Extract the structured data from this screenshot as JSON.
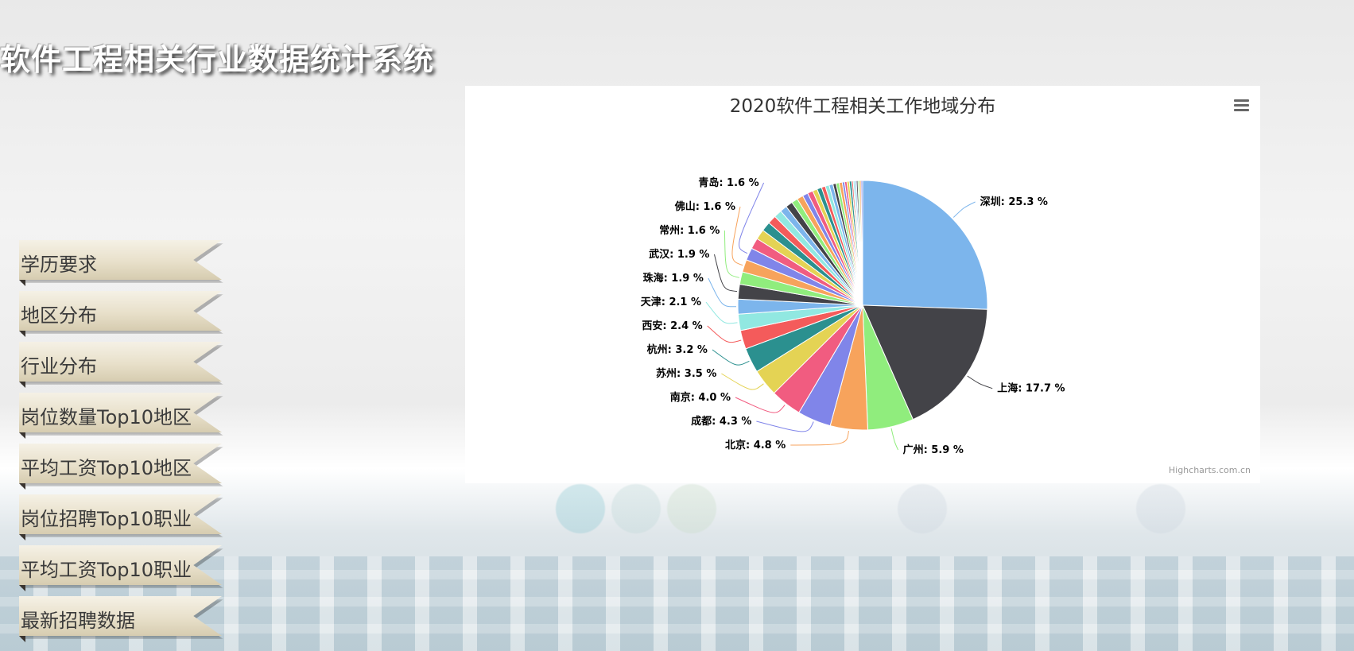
{
  "app": {
    "title": "软件工程相关行业数据统计系统"
  },
  "nav": {
    "items": [
      {
        "label": "学历要求"
      },
      {
        "label": "地区分布"
      },
      {
        "label": "行业分布"
      },
      {
        "label": "岗位数量Top10地区"
      },
      {
        "label": "平均工资Top10地区"
      },
      {
        "label": "岗位招聘Top10职业"
      },
      {
        "label": "平均工资Top10职业"
      },
      {
        "label": "最新招聘数据"
      }
    ]
  },
  "chart": {
    "menu_icon": "hamburger-menu-icon",
    "credit": "Highcharts.com.cn"
  },
  "chart_data": {
    "type": "pie",
    "title": "2020软件工程相关工作地域分布",
    "unit": "%",
    "start_angle_deg": 0,
    "direction": "clockwise",
    "slices": [
      {
        "name": "深圳",
        "value": 25.3,
        "color": "#7cb5ec",
        "labeled": true
      },
      {
        "name": "上海",
        "value": 17.7,
        "color": "#434348",
        "labeled": true
      },
      {
        "name": "广州",
        "value": 5.9,
        "color": "#90ed7d",
        "labeled": true
      },
      {
        "name": "北京",
        "value": 4.8,
        "color": "#f7a35c",
        "labeled": true
      },
      {
        "name": "成都",
        "value": 4.3,
        "color": "#8085e9",
        "labeled": true
      },
      {
        "name": "南京",
        "value": 4.0,
        "color": "#f15c80",
        "labeled": true
      },
      {
        "name": "苏州",
        "value": 3.5,
        "color": "#e4d354",
        "labeled": true
      },
      {
        "name": "杭州",
        "value": 3.2,
        "color": "#2b908f",
        "labeled": true
      },
      {
        "name": "西安",
        "value": 2.4,
        "color": "#f45b5b",
        "labeled": true
      },
      {
        "name": "天津",
        "value": 2.1,
        "color": "#91e8e1",
        "labeled": true
      },
      {
        "name": "珠海",
        "value": 1.9,
        "color": "#7cb5ec",
        "labeled": true
      },
      {
        "name": "武汉",
        "value": 1.9,
        "color": "#434348",
        "labeled": true
      },
      {
        "name": "常州",
        "value": 1.6,
        "color": "#90ed7d",
        "labeled": true
      },
      {
        "name": "佛山",
        "value": 1.6,
        "color": "#f7a35c",
        "labeled": true
      },
      {
        "name": "青岛",
        "value": 1.6,
        "color": "#8085e9",
        "labeled": true
      },
      {
        "value": 1.4,
        "color": "#f15c80",
        "labeled": false
      },
      {
        "value": 1.3,
        "color": "#e4d354",
        "labeled": false
      },
      {
        "value": 1.2,
        "color": "#2b908f",
        "labeled": false
      },
      {
        "value": 1.1,
        "color": "#f45b5b",
        "labeled": false
      },
      {
        "value": 1.0,
        "color": "#91e8e1",
        "labeled": false
      },
      {
        "value": 0.9,
        "color": "#7cb5ec",
        "labeled": false
      },
      {
        "value": 0.9,
        "color": "#434348",
        "labeled": false
      },
      {
        "value": 0.8,
        "color": "#90ed7d",
        "labeled": false
      },
      {
        "value": 0.8,
        "color": "#f7a35c",
        "labeled": false
      },
      {
        "value": 0.7,
        "color": "#8085e9",
        "labeled": false
      },
      {
        "value": 0.7,
        "color": "#f15c80",
        "labeled": false
      },
      {
        "value": 0.6,
        "color": "#e4d354",
        "labeled": false
      },
      {
        "value": 0.6,
        "color": "#2b908f",
        "labeled": false
      },
      {
        "value": 0.5,
        "color": "#f45b5b",
        "labeled": false
      },
      {
        "value": 0.5,
        "color": "#91e8e1",
        "labeled": false
      },
      {
        "value": 0.5,
        "color": "#7cb5ec",
        "labeled": false
      },
      {
        "value": 0.4,
        "color": "#434348",
        "labeled": false
      },
      {
        "value": 0.4,
        "color": "#90ed7d",
        "labeled": false
      },
      {
        "value": 0.4,
        "color": "#f7a35c",
        "labeled": false
      },
      {
        "value": 0.3,
        "color": "#8085e9",
        "labeled": false
      },
      {
        "value": 0.3,
        "color": "#f15c80",
        "labeled": false
      },
      {
        "value": 0.3,
        "color": "#e4d354",
        "labeled": false
      },
      {
        "value": 0.3,
        "color": "#2b908f",
        "labeled": false
      },
      {
        "value": 0.2,
        "color": "#f45b5b",
        "labeled": false
      },
      {
        "value": 0.2,
        "color": "#91e8e1",
        "labeled": false
      },
      {
        "value": 0.2,
        "color": "#7cb5ec",
        "labeled": false
      },
      {
        "value": 0.2,
        "color": "#434348",
        "labeled": false
      },
      {
        "value": 0.2,
        "color": "#90ed7d",
        "labeled": false
      },
      {
        "value": 0.2,
        "color": "#f7a35c",
        "labeled": false
      },
      {
        "value": 0.2,
        "color": "#8085e9",
        "labeled": false
      }
    ]
  }
}
